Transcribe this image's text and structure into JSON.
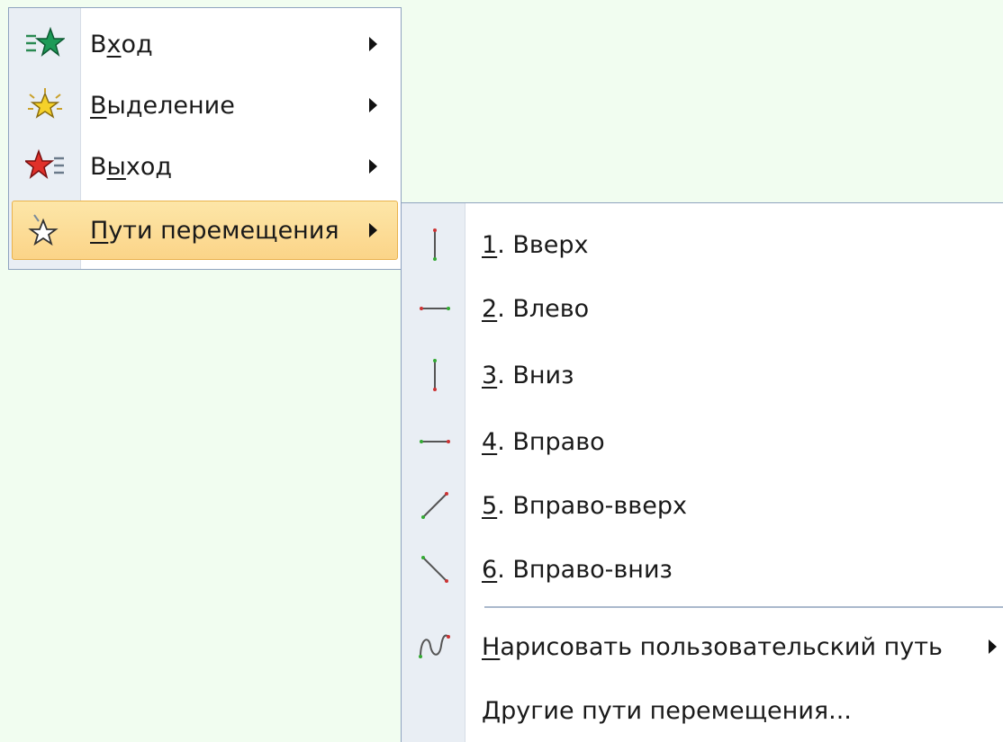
{
  "colors": {
    "background": "#f1fdf0",
    "menu_border": "#8fa3bf",
    "gutter": "#e9eef4",
    "highlight": "#fbd488",
    "star_green": "#1d9a57",
    "star_yellow": "#f5d12a",
    "star_red": "#e0302a"
  },
  "main_menu": {
    "items": [
      {
        "pre": "В",
        "ul": "х",
        "post": "од",
        "icon": "entrance-star-icon",
        "has_submenu": true
      },
      {
        "pre": "",
        "ul": "В",
        "post": "ыделение",
        "icon": "emphasis-star-icon",
        "has_submenu": true
      },
      {
        "pre": "В",
        "ul": "ы",
        "post": "ход",
        "icon": "exit-star-icon",
        "has_submenu": true
      },
      {
        "pre": "",
        "ul": "П",
        "post": "ути перемещения",
        "icon": "motion-path-star-icon",
        "has_submenu": true,
        "selected": true
      }
    ]
  },
  "sub_menu": {
    "items": [
      {
        "ul": "1",
        "post": ". Вверх",
        "icon": "path-up-icon"
      },
      {
        "ul": "2",
        "post": ". Влево",
        "icon": "path-left-icon"
      },
      {
        "ul": "3",
        "post": ". Вниз",
        "icon": "path-down-icon"
      },
      {
        "ul": "4",
        "post": ". Вправо",
        "icon": "path-right-icon"
      },
      {
        "ul": "5",
        "post": ". Вправо-вверх",
        "icon": "path-diagonal-up-icon"
      },
      {
        "ul": "6",
        "post": ". Вправо-вниз",
        "icon": "path-diagonal-down-icon"
      },
      {
        "ul": "Н",
        "post": "арисовать пользовательский путь",
        "icon": "custom-path-icon",
        "has_submenu": true
      },
      {
        "ul": "Д",
        "post": "ругие пути перемещения...",
        "icon": ""
      }
    ]
  }
}
